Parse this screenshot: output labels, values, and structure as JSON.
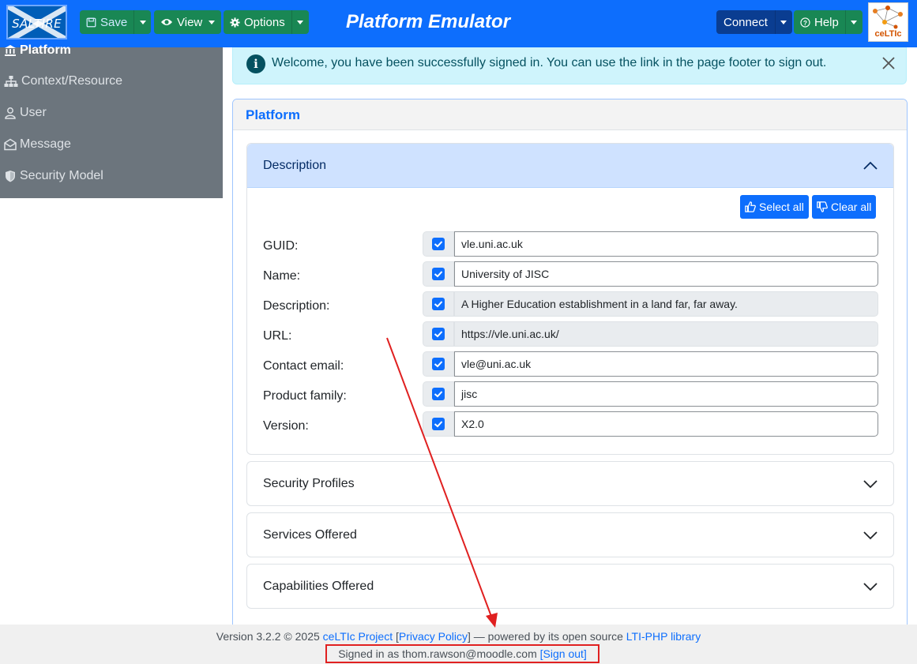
{
  "navbar": {
    "logo_text": "SALTIRE",
    "save_label": "Save",
    "view_label": "View",
    "options_label": "Options",
    "title": "Platform Emulator",
    "connect_label": "Connect",
    "help_label": "Help",
    "partner_logo_text": "ceLTIc"
  },
  "sidebar": {
    "items": [
      {
        "label": "Platform",
        "icon": "bank-icon",
        "active": true
      },
      {
        "label": "Context/Resource",
        "icon": "sitemap-icon"
      },
      {
        "label": "User",
        "icon": "user-icon"
      },
      {
        "label": "Message",
        "icon": "envelope-open-icon"
      },
      {
        "label": "Security Model",
        "icon": "shield-icon"
      }
    ]
  },
  "alert": {
    "message": "Welcome, you have been successfully signed in. You can use the link in the page footer to sign out."
  },
  "card": {
    "title": "Platform",
    "sections": {
      "description": {
        "label": "Description",
        "select_all": "Select all",
        "clear_all": "Clear all",
        "fields": [
          {
            "label": "GUID:",
            "value": "vle.uni.ac.uk",
            "checked": true,
            "readonly": false
          },
          {
            "label": "Name:",
            "value": "University of JISC",
            "checked": true,
            "readonly": false
          },
          {
            "label": "Description:",
            "value": "A Higher Education establishment in a land far, far away.",
            "checked": true,
            "readonly": true
          },
          {
            "label": "URL:",
            "value": "https://vle.uni.ac.uk/",
            "checked": true,
            "readonly": true
          },
          {
            "label": "Contact email:",
            "value": "vle@uni.ac.uk",
            "checked": true,
            "readonly": false
          },
          {
            "label": "Product family:",
            "value": "jisc",
            "checked": true,
            "readonly": false
          },
          {
            "label": "Version:",
            "value": "X2.0",
            "checked": true,
            "readonly": false
          }
        ]
      },
      "security_profiles": "Security Profiles",
      "services_offered": "Services Offered",
      "capabilities_offered": "Capabilities Offered"
    }
  },
  "footer": {
    "version_text": "Version 3.2.2 © 2025 ",
    "project_link": "ceLTIc Project",
    "privacy_open": " [",
    "privacy_link": "Privacy Policy",
    "privacy_close": "] — powered by its open source ",
    "library_link": "LTI-PHP library",
    "signed_in_text": "Signed in as thom.rawson@moodle.com ",
    "sign_out_link": "[Sign out]"
  },
  "annotation": {
    "color": "#e02020"
  }
}
